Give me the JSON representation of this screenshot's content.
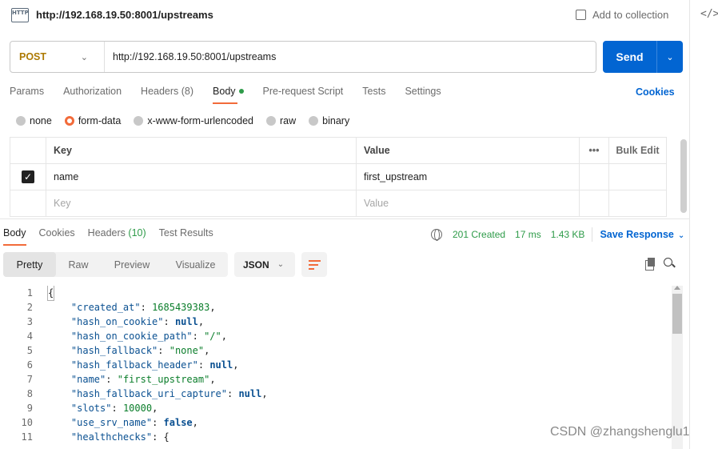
{
  "window": {
    "title": "http://192.168.19.50:8001/upstreams",
    "add_to_collection": "Add to collection",
    "http_badge": "HTTP"
  },
  "request": {
    "method": "POST",
    "url": "http://192.168.19.50:8001/upstreams",
    "send_label": "Send"
  },
  "request_tabs": [
    {
      "label": "Params"
    },
    {
      "label": "Authorization"
    },
    {
      "label": "Headers (8)"
    },
    {
      "label": "Body"
    },
    {
      "label": "Pre-request Script"
    },
    {
      "label": "Tests"
    },
    {
      "label": "Settings"
    }
  ],
  "cookies_link": "Cookies",
  "body_types": [
    {
      "label": "none"
    },
    {
      "label": "form-data"
    },
    {
      "label": "x-www-form-urlencoded"
    },
    {
      "label": "raw"
    },
    {
      "label": "binary"
    }
  ],
  "kv_table": {
    "header": {
      "key": "Key",
      "value": "Value",
      "more": "•••",
      "bulk_edit": "Bulk Edit"
    },
    "rows": [
      {
        "key": "name",
        "value": "first_upstream",
        "checked": true
      }
    ],
    "placeholder": {
      "key": "Key",
      "value": "Value"
    }
  },
  "response_tabs": [
    {
      "label": "Body"
    },
    {
      "label": "Cookies"
    },
    {
      "label": "Headers",
      "count": "(10)"
    },
    {
      "label": "Test Results"
    }
  ],
  "response_meta": {
    "status": "201 Created",
    "time": "17 ms",
    "size": "1.43 KB",
    "save_response": "Save Response"
  },
  "view_modes": [
    {
      "label": "Pretty"
    },
    {
      "label": "Raw"
    },
    {
      "label": "Preview"
    },
    {
      "label": "Visualize"
    }
  ],
  "format": "JSON",
  "code_lines": [
    {
      "n": "1",
      "k": "",
      "v": "{",
      "vt": "brace"
    },
    {
      "n": "2",
      "k": "\"created_at\"",
      "v": "1685439383",
      "vt": "num"
    },
    {
      "n": "3",
      "k": "\"hash_on_cookie\"",
      "v": "null",
      "vt": "kw"
    },
    {
      "n": "4",
      "k": "\"hash_on_cookie_path\"",
      "v": "\"/\"",
      "vt": "str"
    },
    {
      "n": "5",
      "k": "\"hash_fallback\"",
      "v": "\"none\"",
      "vt": "str"
    },
    {
      "n": "6",
      "k": "\"hash_fallback_header\"",
      "v": "null",
      "vt": "kw"
    },
    {
      "n": "7",
      "k": "\"name\"",
      "v": "\"first_upstream\"",
      "vt": "str"
    },
    {
      "n": "8",
      "k": "\"hash_fallback_uri_capture\"",
      "v": "null",
      "vt": "kw"
    },
    {
      "n": "9",
      "k": "\"slots\"",
      "v": "10000",
      "vt": "num"
    },
    {
      "n": "10",
      "k": "\"use_srv_name\"",
      "v": "false",
      "vt": "kw"
    },
    {
      "n": "11",
      "k": "\"healthchecks\"",
      "v": "{",
      "vt": "open"
    }
  ],
  "watermark": "CSDN @zhangshenglu1"
}
